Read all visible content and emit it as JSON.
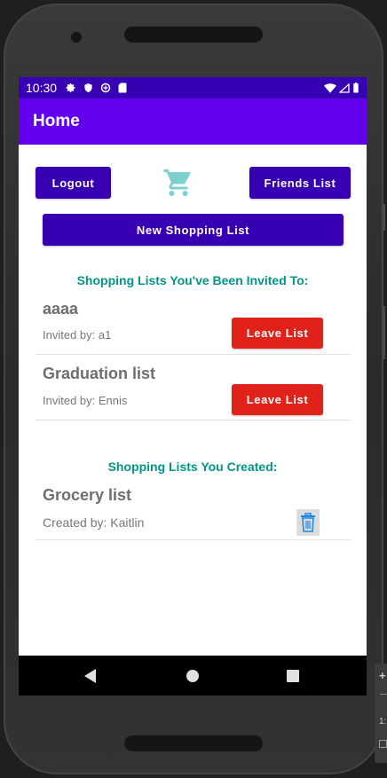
{
  "status_bar": {
    "time": "10:30"
  },
  "app_bar": {
    "title": "Home"
  },
  "buttons": {
    "logout": "Logout",
    "friends_list": "Friends List",
    "new_shopping_list": "New Shopping List"
  },
  "invited": {
    "section_title": "Shopping Lists You've Been Invited To:",
    "items": [
      {
        "name": "aaaa",
        "meta": "Invited by: a1",
        "action": "Leave List"
      },
      {
        "name": "Graduation list",
        "meta": "Invited by: Ennis",
        "action": "Leave List"
      }
    ]
  },
  "created": {
    "section_title": "Shopping Lists You Created:",
    "items": [
      {
        "name": "Grocery list",
        "meta": "Created by: Kaitlin"
      }
    ]
  },
  "side_panel": {
    "text": "1:"
  },
  "icons": {
    "cart": "shopping-cart-icon",
    "trash": "trash-icon",
    "nav_back": "back-icon",
    "nav_home": "home-icon",
    "nav_recents": "recents-icon"
  },
  "colors": {
    "status_bar": "#3700b3",
    "app_bar": "#6200ee",
    "primary_button": "#3700b3",
    "leave_button": "#e0221a",
    "section_title": "#009688",
    "cart_icon": "#7ecfd0",
    "trash_icon": "#1e88e5"
  }
}
